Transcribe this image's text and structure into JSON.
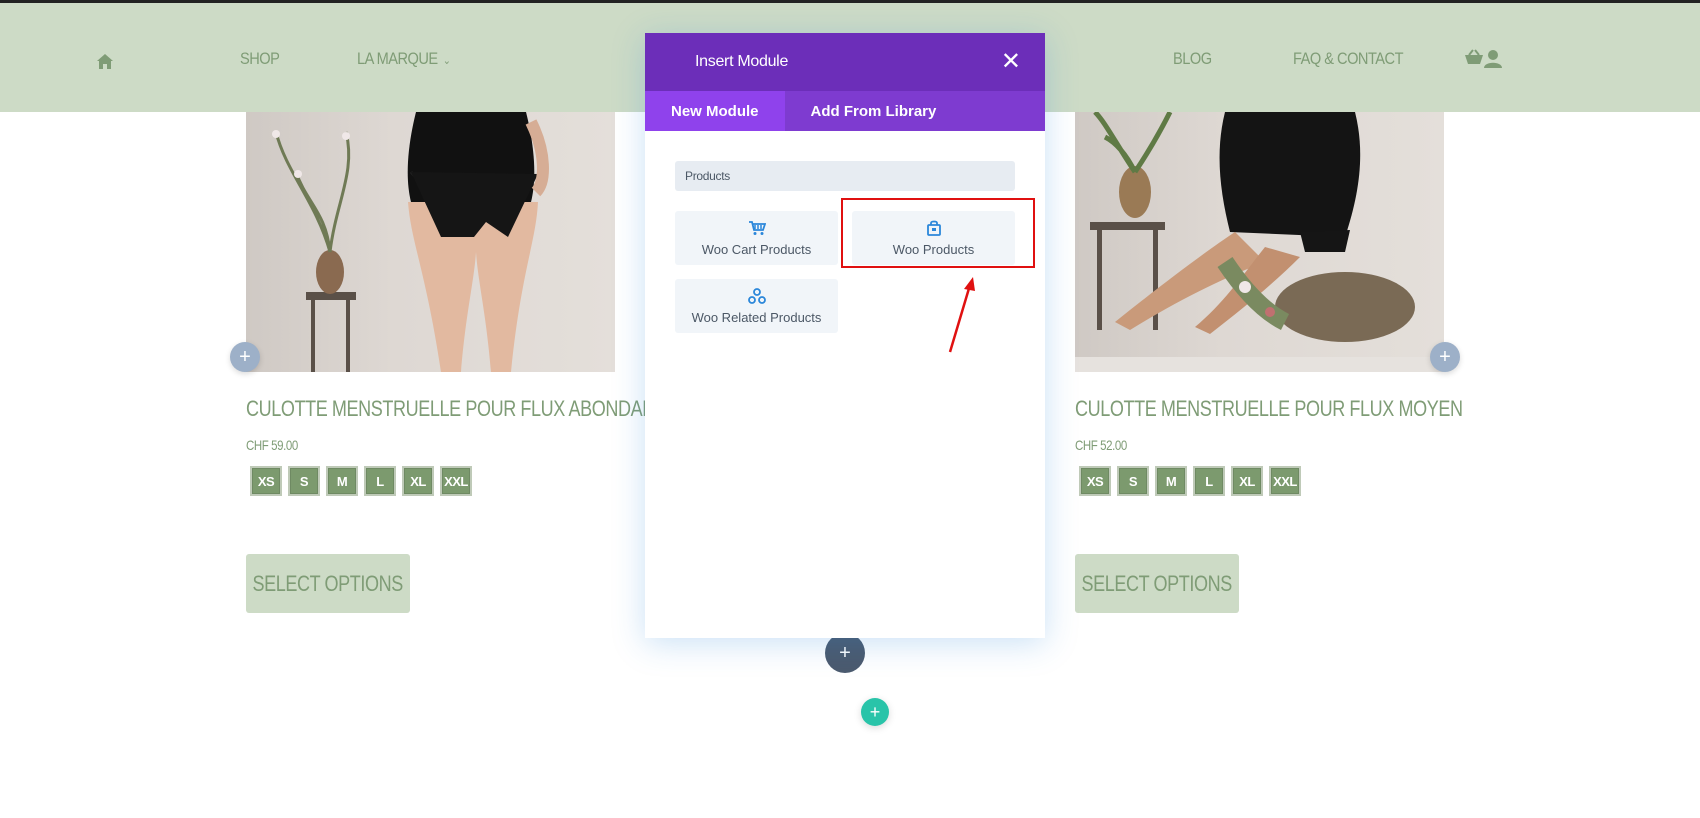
{
  "header": {
    "nav": [
      "SHOP",
      "LA MARQUE",
      "BLOG",
      "FAQ & CONTACT"
    ]
  },
  "products": [
    {
      "title": "CULOTTE MENSTRUELLE POUR FLUX ABONDANT",
      "price": "CHF 59.00",
      "sizes": [
        "XS",
        "S",
        "M",
        "L",
        "XL",
        "XXL"
      ],
      "button": "SELECT OPTIONS"
    },
    {
      "title": "CULOTTE MENSTRUELLE POUR FLUX MOYEN",
      "price": "CHF 52.00",
      "sizes": [
        "XS",
        "S",
        "M",
        "L",
        "XL",
        "XXL"
      ],
      "button": "SELECT OPTIONS"
    }
  ],
  "modal": {
    "title": "Insert Module",
    "tabs": [
      "New Module",
      "Add From Library"
    ],
    "search_value": "Products",
    "modules": [
      "Woo Cart Products",
      "Woo Products",
      "Woo Related Products"
    ]
  },
  "colors": {
    "accent_purple": "#6c2eb9",
    "tab_purple": "#7e3bd0",
    "brand_green": "#7f9c76",
    "header_green": "#cddbc6"
  }
}
